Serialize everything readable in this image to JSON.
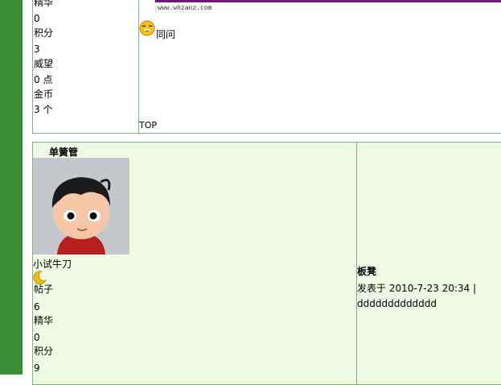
{
  "post1": {
    "stats": [
      "精华",
      "0",
      "积分",
      "3",
      "威望",
      "0 点",
      "金币",
      "3 个"
    ],
    "watermark": "www.whzanz.com",
    "reply_text": "同问",
    "top_link": "TOP"
  },
  "post2": {
    "username": "单簧管",
    "rank": "小试牛刀",
    "stats": [
      "帖子",
      "6",
      "精华",
      "0",
      "积分",
      "9"
    ],
    "floor_title": "板凳",
    "post_meta": "发表于  2010-7-23 20:34 |",
    "content": "ddddddddddddd"
  },
  "colors": {
    "sidebar": "#3a8f36",
    "border": "#7fb37a",
    "post2_bg": "#eefae6",
    "purple_bar": "#6b1a78"
  },
  "icons": {
    "reply_emoji": "laughing-face-icon",
    "rank_icon": "crescent-moon-icon",
    "avatar": "cartoon-boy-avatar"
  }
}
